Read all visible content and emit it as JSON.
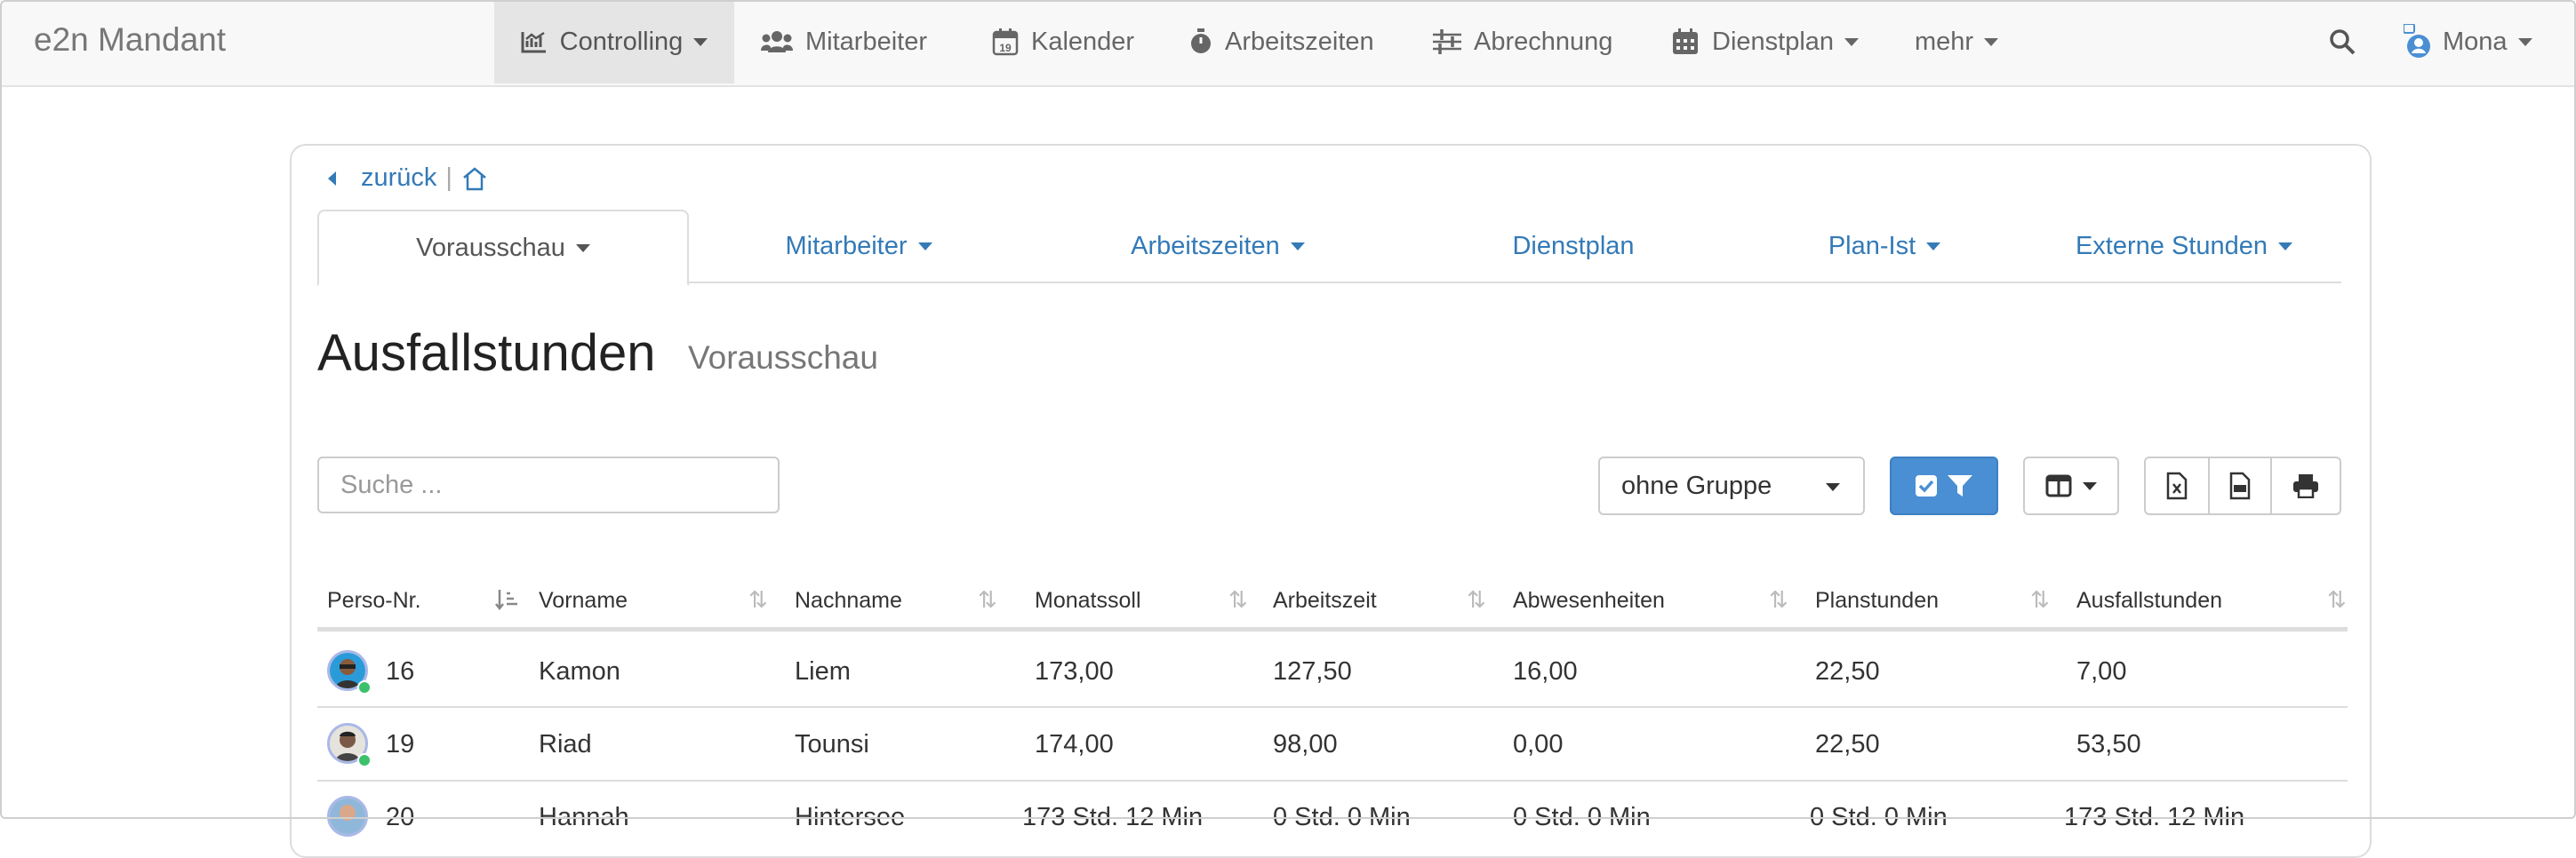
{
  "navbar": {
    "brand": "e2n Mandant",
    "items": [
      {
        "label": "Controlling",
        "icon": "chart-line-icon"
      },
      {
        "label": "Mitarbeiter",
        "icon": "users-icon"
      },
      {
        "label": "Kalender",
        "icon": "calendar-19-icon"
      },
      {
        "label": "Arbeitszeiten",
        "icon": "stopwatch-icon"
      },
      {
        "label": "Abrechnung",
        "icon": "sliders-icon"
      },
      {
        "label": "Dienstplan",
        "icon": "calendar-grid-icon"
      },
      {
        "label": "mehr"
      }
    ],
    "user": "Mona"
  },
  "breadcrumb": {
    "back_label": "zurück",
    "separator": "|"
  },
  "tabs": [
    {
      "label": "Vorausschau",
      "active": true
    },
    {
      "label": "Mitarbeiter"
    },
    {
      "label": "Arbeitszeiten"
    },
    {
      "label": "Dienstplan"
    },
    {
      "label": "Plan-Ist"
    },
    {
      "label": "Externe Stunden"
    }
  ],
  "page": {
    "title": "Ausfallstunden",
    "subtitle": "Vorausschau"
  },
  "toolbar": {
    "search_placeholder": "Suche ...",
    "group_select": "ohne Gruppe"
  },
  "table": {
    "columns": [
      "Perso-Nr.",
      "Vorname",
      "Nachname",
      "Monatssoll",
      "Arbeitszeit",
      "Abwesenheiten",
      "Planstunden",
      "Ausfallstunden"
    ],
    "rows": [
      {
        "nr": "16",
        "vorname": "Kamon",
        "nachname": "Liem",
        "monatssoll": "173,00",
        "arbeitszeit": "127,50",
        "abwesenheiten": "16,00",
        "planstunden": "22,50",
        "ausfallstunden": "7,00"
      },
      {
        "nr": "19",
        "vorname": "Riad",
        "nachname": "Tounsi",
        "monatssoll": "174,00",
        "arbeitszeit": "98,00",
        "abwesenheiten": "0,00",
        "planstunden": "22,50",
        "ausfallstunden": "53,50"
      },
      {
        "nr": "20",
        "vorname": "Hannah",
        "nachname": "Hintersee",
        "monatssoll": "173 Std. 12 Min",
        "arbeitszeit": "0 Std. 0 Min",
        "abwesenheiten": "0 Std. 0 Min",
        "planstunden": "0 Std. 0 Min",
        "ausfallstunden": "173 Std. 12 Min"
      }
    ]
  },
  "colors": {
    "link": "#337ab7",
    "primary": "#4a8fd4",
    "online": "#3cc06a"
  }
}
